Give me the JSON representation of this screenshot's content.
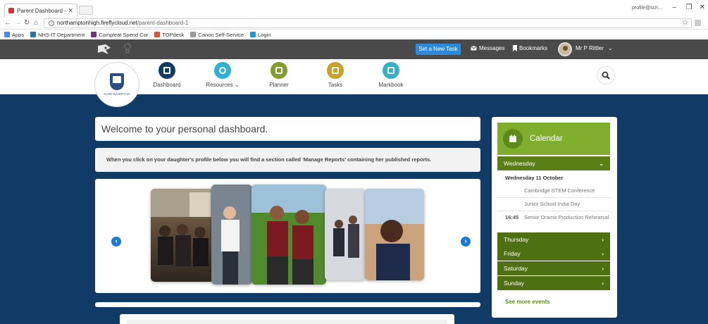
{
  "browser": {
    "tab_title": "Parent Dashboard — No",
    "tab_close": "✕",
    "profile_label": "profile@sch...",
    "url_host": "northamptonhigh.fireflycloud.net",
    "url_path": "/parent-dashboard-1",
    "bookmarks": [
      {
        "label": "Apps",
        "color": "#4a8af4"
      },
      {
        "label": "NHS-IT Department",
        "color": "#2f6fb5"
      },
      {
        "label": "Compleat Spend Cor",
        "color": "#7a2b82"
      },
      {
        "label": "TOPdesk",
        "color": "#e0532a"
      },
      {
        "label": "Canon Self-Service",
        "color": "#9a9a9a"
      },
      {
        "label": "Login",
        "color": "#1a9ad6"
      }
    ]
  },
  "topbar": {
    "task_button": "Set a New Task",
    "messages": "Messages",
    "bookmarks": "Bookmarks",
    "user": "Mr P Rittler"
  },
  "nav": {
    "school_name": "NORTHAMPTON",
    "items": [
      {
        "label": "Dashboard",
        "color": "#0f3b66"
      },
      {
        "label": "Resources",
        "color": "#2fb0d6"
      },
      {
        "label": "Planner",
        "color": "#7f9e2a"
      },
      {
        "label": "Tasks",
        "color": "#c9a22a"
      },
      {
        "label": "Markbook",
        "color": "#35b0c9"
      }
    ]
  },
  "main": {
    "welcome": "Welcome to your personal dashboard.",
    "info": "When you click on your daughter's profile below you will find a section called 'Manage Reports' containing her published reports."
  },
  "calendar": {
    "title": "Calendar",
    "expanded_day": "Wednesday",
    "date_heading": "Wednesday 11 October",
    "events": [
      {
        "time": "",
        "title": "Cambridge STEM Conference"
      },
      {
        "time": "",
        "title": "Junior School India Day"
      },
      {
        "time": "16:45",
        "title": "Senior Drama Production Rehearsal"
      }
    ],
    "days": [
      "Thursday",
      "Friday",
      "Saturday",
      "Sunday"
    ],
    "see_more": "See more events",
    "colors": {
      "expanded": "#5a7f14",
      "collapsed": "#4e6f12",
      "header": "#7fad2e"
    }
  }
}
